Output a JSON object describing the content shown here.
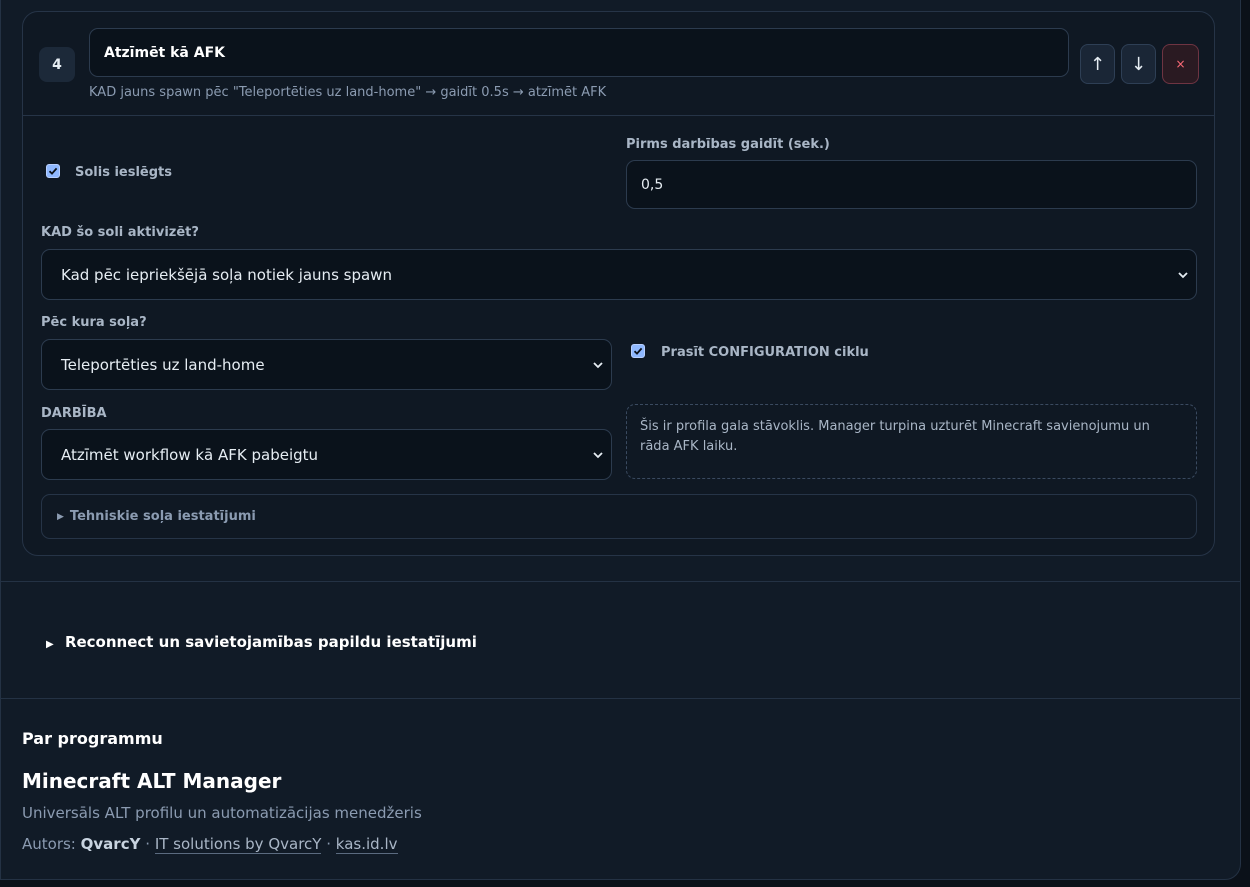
{
  "step": {
    "number": "4",
    "title": "Atzīmēt kā AFK",
    "description": "KAD jauns spawn pēc \"Teleportēties uz land-home\" → gaidīt 0.5s → atzīmēt AFK",
    "buttons": {
      "up": "↑",
      "down": "↓",
      "delete": "×"
    },
    "enabled_label": "Solis ieslēgts",
    "wait_label": "Pirms darbības gaidīt (sek.)",
    "wait_value": "0,5",
    "trigger_label": "KAD šo soli aktivizēt?",
    "trigger_value": "Kad pēc iepriekšējā soļa notiek jauns spawn",
    "after_label": "Pēc kura soļa?",
    "after_value": "Teleportēties uz land-home",
    "config_label": "Prasīt CONFIGURATION ciklu",
    "action_label": "DARBĪBA",
    "action_value": "Atzīmēt workflow kā AFK pabeigtu",
    "info_text": "Šis ir profila gala stāvoklis. Manager turpina uzturēt Minecraft savienojumu un rāda AFK laiku.",
    "tech_label": "Tehniskie soļa iestatījumi"
  },
  "reconnect_label": "Reconnect un savietojamības papildu iestatījumi",
  "about": {
    "heading": "Par programmu",
    "app_name": "Minecraft ALT Manager",
    "subtitle": "Universāls ALT profilu un automatizācijas menedžeris",
    "author_prefix": "Autors:",
    "author_name": "QvarcY",
    "sep1": "·",
    "link1": "IT solutions by QvarcY",
    "sep2": "·",
    "link2": "kas.id.lv"
  }
}
